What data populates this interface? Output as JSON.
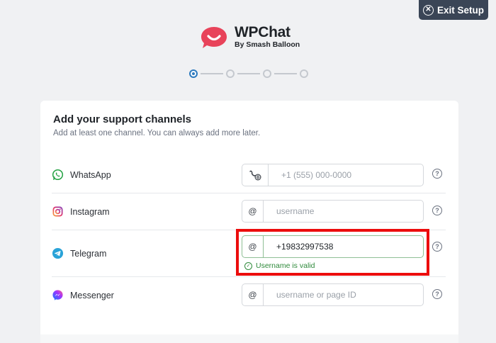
{
  "header": {
    "exit_label": "Exit Setup",
    "brand_name": "WPChat",
    "brand_sub": "By Smash Balloon"
  },
  "stepper": {
    "total_steps": 4,
    "current_step": 1
  },
  "card": {
    "title": "Add your support channels",
    "subtitle": "Add at least one channel. You can always add more later."
  },
  "channels": [
    {
      "label": "WhatsApp",
      "prefix": "",
      "prefix_icon": "phone-globe-icon",
      "value": "",
      "placeholder": "+1 (555) 000-0000"
    },
    {
      "label": "Instagram",
      "prefix": "@",
      "value": "",
      "placeholder": "username"
    },
    {
      "label": "Telegram",
      "prefix": "@",
      "value": "+19832997538",
      "placeholder": "",
      "status": "Username is valid"
    },
    {
      "label": "Messenger",
      "prefix": "@",
      "value": "",
      "placeholder": "username or page ID"
    }
  ],
  "colors": {
    "brand_red": "#e8435a",
    "exit_bg": "#3a4556",
    "step_active": "#2f7bbf",
    "valid_green": "#2f8a3b",
    "highlight_red": "#ec0d0d"
  },
  "help_symbol": "?"
}
